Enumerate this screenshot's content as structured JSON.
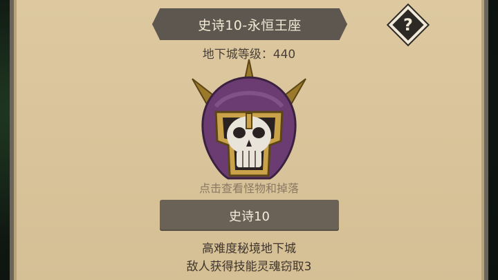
{
  "header": {
    "title": "史诗10-永恒王座",
    "help_symbol": "?"
  },
  "dungeon": {
    "level_text": "地下城等级：440",
    "hint": "点击查看怪物和掉落"
  },
  "difficulty": {
    "label": "史诗10"
  },
  "description": {
    "line1": "高难度秘境地下城",
    "line2": "敌人获得技能灵魂窃取3"
  },
  "colors": {
    "parchment": "#d8c39a",
    "title_bar": "#5e574f",
    "button": "#6a6157",
    "helmet_purple": "#6b3c72",
    "helmet_gold": "#b08a2e"
  },
  "icons": {
    "boss": "armored-skull-icon",
    "help": "question-icon"
  }
}
